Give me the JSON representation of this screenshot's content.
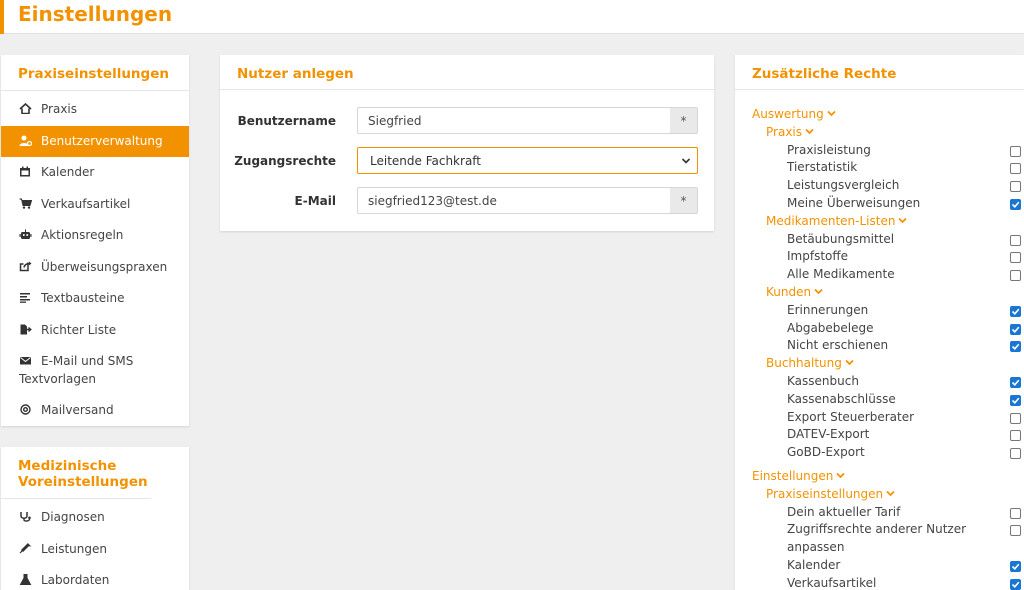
{
  "page_title": "Einstellungen",
  "colors": {
    "accent": "#f39200",
    "checkbox_on": "#1976d2"
  },
  "sidebar": {
    "section1_title": "Praxiseinstellungen",
    "items": [
      {
        "label": "Praxis",
        "icon": "home-icon"
      },
      {
        "label": "Benutzerverwaltung",
        "icon": "user-gear-icon",
        "active": true
      },
      {
        "label": "Kalender",
        "icon": "calendar-icon"
      },
      {
        "label": "Verkaufsartikel",
        "icon": "shopping-cart-icon"
      },
      {
        "label": "Aktionsregeln",
        "icon": "robot-icon"
      },
      {
        "label": "Überweisungspraxen",
        "icon": "share-icon"
      },
      {
        "label": "Textbausteine",
        "icon": "text-align-icon"
      },
      {
        "label": "Richter Liste",
        "icon": "file-export-icon"
      },
      {
        "label": "E-Mail und SMS Textvorlagen",
        "icon": "envelope-icon"
      },
      {
        "label": "Mailversand",
        "icon": "at-icon"
      }
    ],
    "section2_title": "Medizinische Voreinstellungen",
    "items2": [
      {
        "label": "Diagnosen",
        "icon": "stethoscope-icon"
      },
      {
        "label": "Leistungen",
        "icon": "syringe-icon"
      },
      {
        "label": "Labordaten",
        "icon": "flask-icon"
      }
    ]
  },
  "form": {
    "title": "Nutzer anlegen",
    "username_label": "Benutzername",
    "username_value": "Siegfried",
    "required_marker": "*",
    "access_label": "Zugangsrechte",
    "access_value": "Leitende Fachkraft",
    "email_label": "E-Mail",
    "email_value": "siegfried123@test.de"
  },
  "rights": {
    "title": "Zusätzliche Rechte",
    "rows": [
      {
        "level": 1,
        "label": "Auswertung"
      },
      {
        "level": 2,
        "label": "Praxis"
      },
      {
        "level": 3,
        "label": "Praxisleistung",
        "checked": false
      },
      {
        "level": 3,
        "label": "Tierstatistik",
        "checked": false
      },
      {
        "level": 3,
        "label": "Leistungsvergleich",
        "checked": false
      },
      {
        "level": 3,
        "label": "Meine Überweisungen",
        "checked": true
      },
      {
        "level": 2,
        "label": "Medikamenten-Listen"
      },
      {
        "level": 3,
        "label": "Betäubungsmittel",
        "checked": false
      },
      {
        "level": 3,
        "label": "Impfstoffe",
        "checked": false
      },
      {
        "level": 3,
        "label": "Alle Medikamente",
        "checked": false
      },
      {
        "level": 2,
        "label": "Kunden"
      },
      {
        "level": 3,
        "label": "Erinnerungen",
        "checked": true
      },
      {
        "level": 3,
        "label": "Abgabebelege",
        "checked": true
      },
      {
        "level": 3,
        "label": "Nicht erschienen",
        "checked": true
      },
      {
        "level": 2,
        "label": "Buchhaltung"
      },
      {
        "level": 3,
        "label": "Kassenbuch",
        "checked": true
      },
      {
        "level": 3,
        "label": "Kassenabschlüsse",
        "checked": true
      },
      {
        "level": 3,
        "label": "Export Steuerberater",
        "checked": false
      },
      {
        "level": 3,
        "label": "DATEV-Export",
        "checked": false
      },
      {
        "level": 3,
        "label": "GoBD-Export",
        "checked": false
      },
      {
        "level": 1,
        "label": "Einstellungen"
      },
      {
        "level": 2,
        "label": "Praxiseinstellungen"
      },
      {
        "level": 3,
        "label": "Dein aktueller Tarif",
        "checked": false
      },
      {
        "level": 3,
        "label": "Zugriffsrechte anderer Nutzer anpassen",
        "checked": false
      },
      {
        "level": 3,
        "label": "Kalender",
        "checked": true
      },
      {
        "level": 3,
        "label": "Verkaufsartikel",
        "checked": true
      }
    ]
  }
}
